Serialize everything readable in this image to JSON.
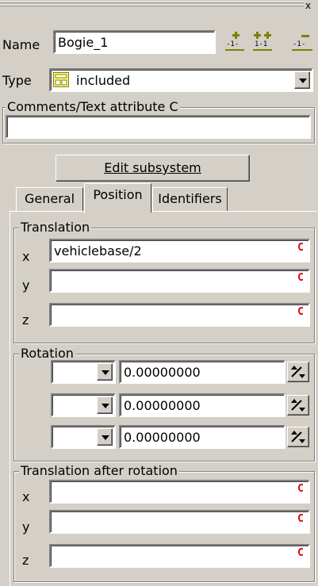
{
  "window": {
    "close_glyph": "x"
  },
  "name": {
    "label": "Name",
    "value": "Bogie_1"
  },
  "toolbar_icons": [
    "add-member-icon",
    "add-member-group-icon",
    "remove-member-icon"
  ],
  "type": {
    "label": "Type",
    "value": "included",
    "icon": "subsystem-icon"
  },
  "comments": {
    "label": "Comments/Text attribute C",
    "value": ""
  },
  "edit_button": {
    "label": "Edit subsystem"
  },
  "tabs": [
    {
      "label": "General",
      "active": false
    },
    {
      "label": "Position",
      "active": true
    },
    {
      "label": "Identifiers",
      "active": false
    }
  ],
  "translation": {
    "title": "Translation",
    "rows": [
      {
        "axis": "x",
        "value": "vehiclebase/2",
        "marker": "C"
      },
      {
        "axis": "y",
        "value": "",
        "marker": "C"
      },
      {
        "axis": "z",
        "value": "",
        "marker": "C"
      }
    ]
  },
  "rotation": {
    "title": "Rotation",
    "rows": [
      {
        "axis_select": "",
        "value": "0.00000000"
      },
      {
        "axis_select": "",
        "value": "0.00000000"
      },
      {
        "axis_select": "",
        "value": "0.00000000"
      }
    ]
  },
  "translation_after": {
    "title": "Translation after rotation",
    "rows": [
      {
        "axis": "x",
        "value": "",
        "marker": "C"
      },
      {
        "axis": "y",
        "value": "",
        "marker": "C"
      },
      {
        "axis": "z",
        "value": "",
        "marker": "C"
      }
    ]
  },
  "colors": {
    "bg": "#d4d0c8",
    "marker_red": "#e00000",
    "icon_olive": "#808000"
  }
}
